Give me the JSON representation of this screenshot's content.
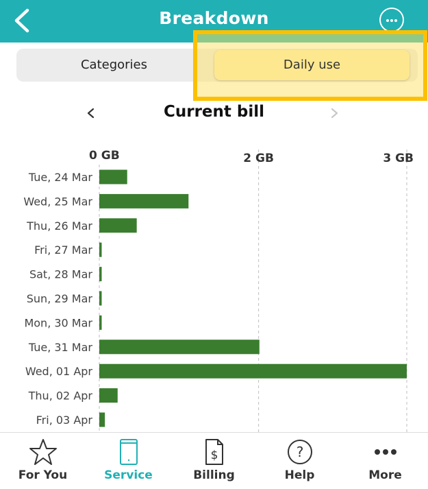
{
  "header": {
    "title": "Breakdown"
  },
  "segments": {
    "categories": "Categories",
    "daily_use": "Daily use"
  },
  "period": {
    "title": "Current bill"
  },
  "colors": {
    "header": "#21b0b4",
    "bar": "#3a7d2f",
    "highlight_border": "#fcc000",
    "active_tab": "#21b0b4"
  },
  "chart_data": {
    "type": "bar",
    "orientation": "horizontal",
    "categories": [
      "Tue, 24 Mar",
      "Wed, 25 Mar",
      "Thu, 26 Mar",
      "Fri, 27 Mar",
      "Sat, 28 Mar",
      "Sun, 29 Mar",
      "Mon, 30 Mar",
      "Tue, 31 Mar",
      "Wed, 01 Apr",
      "Thu, 02 Apr",
      "Fri, 03 Apr"
    ],
    "values": [
      0.35,
      1.12,
      0.47,
      0.03,
      0.03,
      0.03,
      0.03,
      2.01,
      3.86,
      0.23,
      0.07
    ],
    "ticks": [
      {
        "value": 0,
        "label": "0 GB"
      },
      {
        "value": 2,
        "label": "2 GB"
      },
      {
        "value": 3.86,
        "label": "3 GB"
      }
    ],
    "unit": "GB",
    "xlim": [
      0,
      3.86
    ],
    "grid": true
  },
  "tabs": [
    {
      "id": "for-you",
      "label": "For You",
      "icon": "star-icon",
      "active": false
    },
    {
      "id": "service",
      "label": "Service",
      "icon": "phone-icon",
      "active": true
    },
    {
      "id": "billing",
      "label": "Billing",
      "icon": "bill-icon",
      "active": false
    },
    {
      "id": "help",
      "label": "Help",
      "icon": "help-icon",
      "active": false
    },
    {
      "id": "more",
      "label": "More",
      "icon": "more-dots-icon",
      "active": false
    }
  ]
}
